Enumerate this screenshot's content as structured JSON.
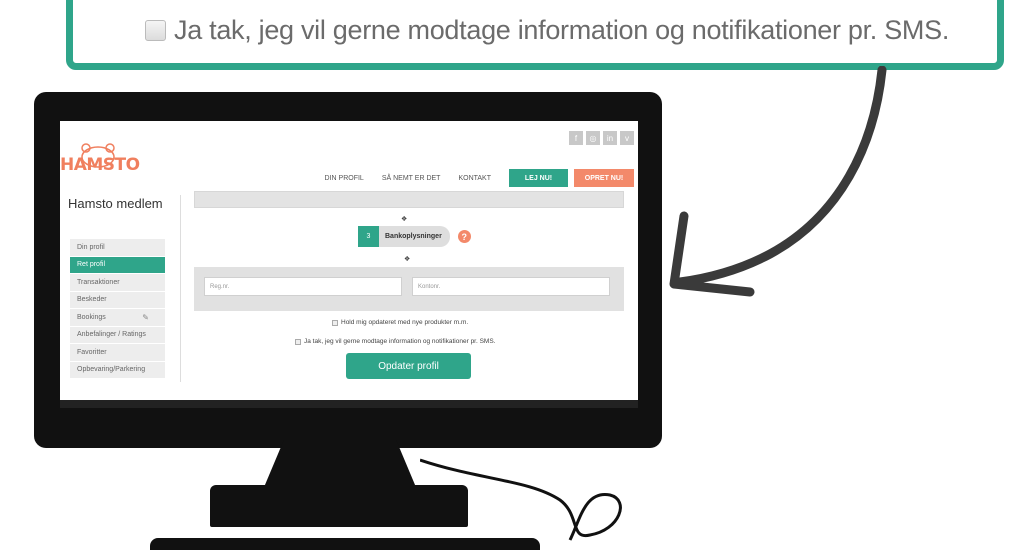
{
  "callout": {
    "checkbox_text": "Ja tak, jeg vil gerne modtage information og notifikationer pr. SMS."
  },
  "colors": {
    "accent_green": "#2fa58a",
    "accent_orange": "#f3896a",
    "monitor": "#111111"
  },
  "site": {
    "logo_text": "HAMSTO",
    "social_icons": [
      "facebook-icon",
      "instagram-icon",
      "linkedin-icon",
      "vimeo-icon"
    ],
    "social_glyphs": [
      "f",
      "◎",
      "in",
      "v"
    ],
    "nav": {
      "profile": "DIN PROFIL",
      "how": "SÅ NEMT ER DET",
      "contact": "KONTAKT",
      "rent_now": "LEJ NU!",
      "create_now": "OPRET NU!"
    }
  },
  "sidebar": {
    "title": "Hamsto medlem",
    "items": [
      {
        "label": "Din profil",
        "active": false
      },
      {
        "label": "Ret profil",
        "active": true
      },
      {
        "label": "Transaktioner",
        "active": false
      },
      {
        "label": "Beskeder",
        "active": false
      },
      {
        "label": "Bookings",
        "active": false
      },
      {
        "label": "Anbefalinger / Ratings",
        "active": false
      },
      {
        "label": "Favoritter",
        "active": false
      },
      {
        "label": "Opbevaring/Parkering",
        "active": false
      }
    ]
  },
  "form": {
    "step_number": "3",
    "step_label": "Bankoplysninger",
    "help_glyph": "?",
    "reg_placeholder": "Reg.nr.",
    "account_placeholder": "Kontonr.",
    "newsletter_label": "Hold mig opdateret med nye produkter m.m.",
    "sms_label": "Ja tak, jeg vil gerne modtage information og notifikationer pr. SMS.",
    "submit_label": "Opdater profil"
  }
}
